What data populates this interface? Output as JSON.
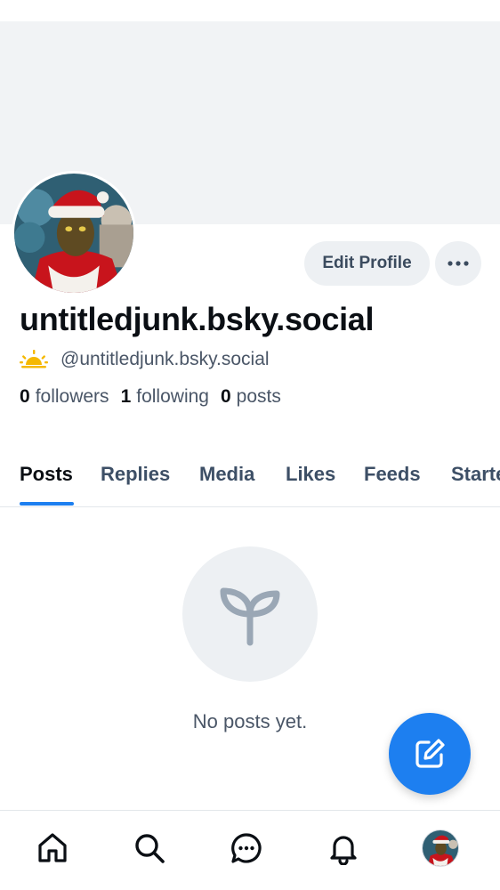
{
  "profile": {
    "display_name": "untitledjunk.bsky.social",
    "handle": "@untitledjunk.bsky.social",
    "avatar_icon": "user-avatar-santa",
    "status_icon": "sunrise-emoji"
  },
  "actions": {
    "edit_profile_label": "Edit Profile",
    "more_icon": "ellipsis-icon"
  },
  "stats": {
    "followers_count": "0",
    "followers_label": "followers",
    "following_count": "1",
    "following_label": "following",
    "posts_count": "0",
    "posts_label": "posts"
  },
  "tabs": [
    {
      "label": "Posts",
      "active": true
    },
    {
      "label": "Replies"
    },
    {
      "label": "Media"
    },
    {
      "label": "Likes"
    },
    {
      "label": "Feeds"
    },
    {
      "label": "Starter Packs"
    }
  ],
  "empty_state": {
    "icon": "sprout-icon",
    "message": "No posts yet."
  },
  "fab": {
    "icon": "compose-icon"
  },
  "bottom_nav": {
    "items": [
      "home-icon",
      "search-icon",
      "chat-icon",
      "bell-icon",
      "profile-avatar"
    ]
  },
  "colors": {
    "accent": "#1d7ff0",
    "banner": "#f1f3f5",
    "muted_text": "#4a5667",
    "button_bg": "#edf0f3"
  }
}
